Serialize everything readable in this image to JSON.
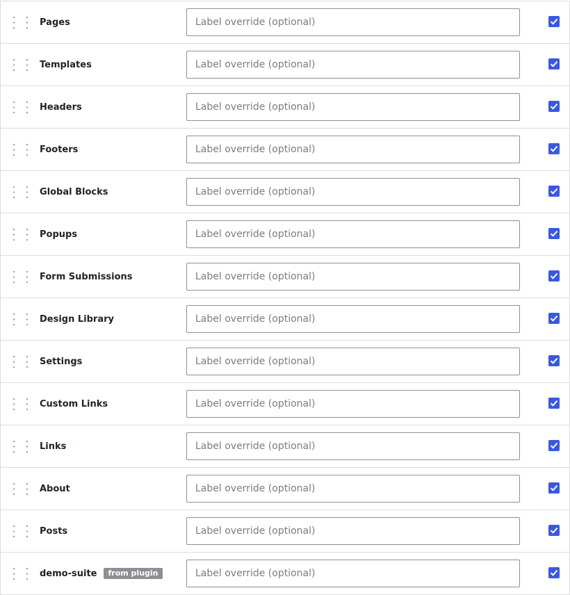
{
  "placeholder": "Label override (optional)",
  "colors": {
    "accent": "#3858e9",
    "badge": "#8c8f94",
    "border": "#dcdcde"
  },
  "items": [
    {
      "label": "Pages",
      "badge": "",
      "checked": true
    },
    {
      "label": "Templates",
      "badge": "",
      "checked": true
    },
    {
      "label": "Headers",
      "badge": "",
      "checked": true
    },
    {
      "label": "Footers",
      "badge": "",
      "checked": true
    },
    {
      "label": "Global Blocks",
      "badge": "",
      "checked": true
    },
    {
      "label": "Popups",
      "badge": "",
      "checked": true
    },
    {
      "label": "Form Submissions",
      "badge": "",
      "checked": true
    },
    {
      "label": "Design Library",
      "badge": "",
      "checked": true
    },
    {
      "label": "Settings",
      "badge": "",
      "checked": true
    },
    {
      "label": "Custom Links",
      "badge": "",
      "checked": true
    },
    {
      "label": "Links",
      "badge": "",
      "checked": true
    },
    {
      "label": "About",
      "badge": "",
      "checked": true
    },
    {
      "label": "Posts",
      "badge": "",
      "checked": true
    },
    {
      "label": "demo-suite",
      "badge": "from plugin",
      "checked": true
    }
  ]
}
